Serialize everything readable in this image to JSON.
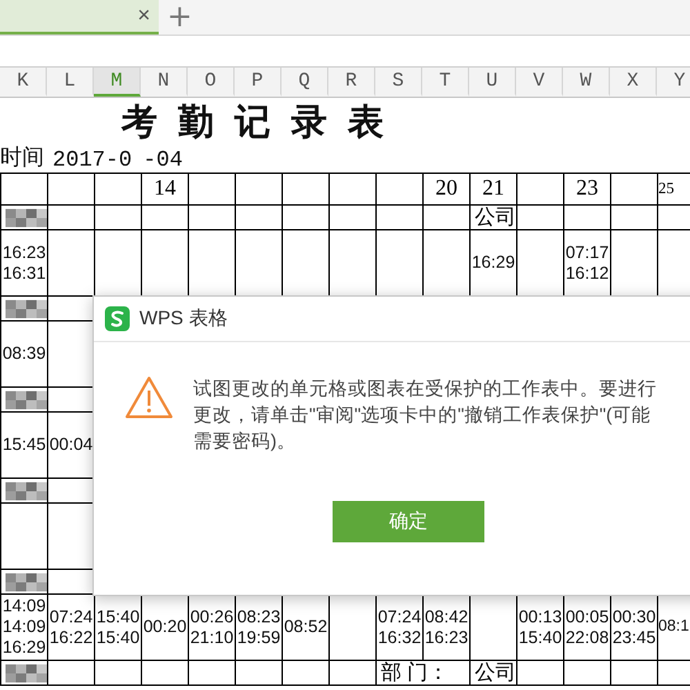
{
  "tabs": [
    {
      "selected": true,
      "close": "×"
    }
  ],
  "new_tab": "+",
  "columns": [
    {
      "label": "K",
      "selected": false
    },
    {
      "label": "L",
      "selected": false
    },
    {
      "label": "M",
      "selected": true
    },
    {
      "label": "N",
      "selected": false
    },
    {
      "label": "O",
      "selected": false
    },
    {
      "label": "P",
      "selected": false
    },
    {
      "label": "Q",
      "selected": false
    },
    {
      "label": "R",
      "selected": false
    },
    {
      "label": "S",
      "selected": false
    },
    {
      "label": "T",
      "selected": false
    },
    {
      "label": "U",
      "selected": false
    },
    {
      "label": "V",
      "selected": false
    },
    {
      "label": "W",
      "selected": false
    },
    {
      "label": "X",
      "selected": false
    },
    {
      "label": "Y",
      "selected": false
    }
  ],
  "sheet_title": "考勤记录表",
  "date": {
    "label": "时间",
    "value_start": "2017-0",
    "value_end": "-04"
  },
  "rows": [
    {
      "kind": "days",
      "cells": [
        null,
        null,
        null,
        "14",
        null,
        null,
        null,
        null,
        null,
        "20",
        "21",
        null,
        "23",
        null,
        "25"
      ]
    },
    {
      "kind": "name",
      "cells": [
        null,
        null,
        null,
        null,
        null,
        null,
        null,
        null,
        null,
        null,
        "公司",
        null,
        null,
        null,
        null
      ]
    },
    {
      "kind": "times",
      "cells": [
        "16:23\n16:31",
        null,
        null,
        null,
        null,
        null,
        null,
        null,
        null,
        null,
        "16:29",
        null,
        "07:17\n16:12",
        null,
        null
      ]
    },
    {
      "kind": "name",
      "cells": [
        null,
        null,
        null,
        null,
        null,
        null,
        null,
        null,
        null,
        null,
        null,
        null,
        null,
        null,
        null
      ]
    },
    {
      "kind": "times",
      "cells": [
        "08:39",
        null,
        null,
        null,
        null,
        null,
        null,
        null,
        null,
        null,
        null,
        null,
        null,
        null,
        null
      ]
    },
    {
      "kind": "name",
      "cells": [
        null,
        null,
        null,
        null,
        null,
        null,
        null,
        null,
        null,
        null,
        null,
        null,
        null,
        null,
        null
      ]
    },
    {
      "kind": "times",
      "cells": [
        "15:45",
        "00:04",
        null,
        null,
        null,
        null,
        null,
        null,
        null,
        null,
        null,
        null,
        null,
        null,
        null
      ]
    },
    {
      "kind": "name",
      "cells": [
        null,
        null,
        null,
        null,
        null,
        null,
        null,
        null,
        null,
        null,
        null,
        null,
        null,
        null,
        null
      ]
    },
    {
      "kind": "times",
      "cells": [
        null,
        null,
        null,
        null,
        null,
        null,
        null,
        null,
        null,
        null,
        null,
        null,
        null,
        null,
        null
      ]
    },
    {
      "kind": "name",
      "cells": [
        null,
        null,
        null,
        null,
        null,
        null,
        null,
        null,
        null,
        null,
        null,
        null,
        null,
        null,
        null
      ]
    },
    {
      "kind": "times",
      "cells": [
        "14:09\n14:09\n16:29",
        "07:24\n16:22",
        "15:40\n15:40",
        "00:20",
        "00:26\n21:10",
        "08:23\n19:59",
        "08:52",
        null,
        "07:24\n16:32",
        "08:42\n16:23",
        null,
        "00:13\n15:40",
        "00:05\n22:08",
        "00:30\n23:45",
        "08:1"
      ]
    },
    {
      "kind": "name",
      "cells": [
        null,
        null,
        null,
        null,
        null,
        null,
        null,
        null,
        "部 门：",
        null,
        "公司",
        null,
        null,
        null,
        null
      ]
    }
  ],
  "dialog": {
    "title": "WPS 表格",
    "message": "试图更改的单元格或图表在受保护的工作表中。要进行更改，请单击\"审阅\"选项卡中的\"撤销工作表保护\"(可能需要密码)。",
    "button": "确定"
  }
}
